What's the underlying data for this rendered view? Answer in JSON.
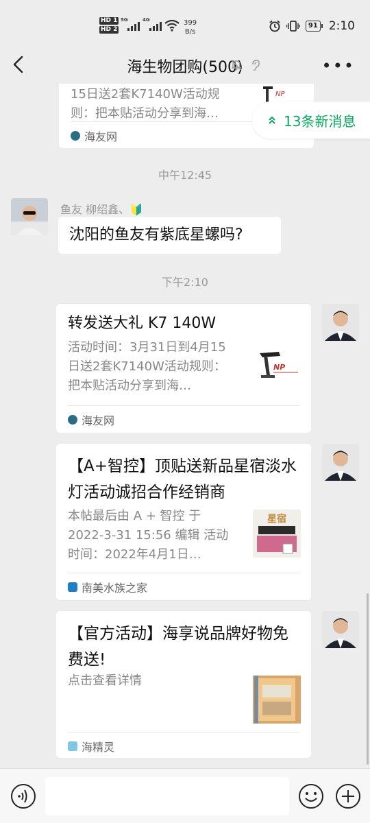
{
  "status_bar": {
    "sim1": "HD 1",
    "sim2": "HD 2",
    "net1": "5G",
    "net2": "4G",
    "speed_value": "399",
    "speed_unit": "B/s",
    "battery": "91",
    "time": "2:10"
  },
  "header": {
    "title": "海生物团购(500)"
  },
  "new_messages": "13条新消息",
  "messages": {
    "card_top": {
      "desc_line1": "15日送2套K7140W活动规",
      "desc_line2": "则：把本贴活动分享到海…",
      "source": "海友网"
    },
    "time1": "中午12:45",
    "msg1": {
      "sender": "鱼友 柳绍鑫、🔰",
      "text": "沈阳的鱼友有紫底星螺吗?"
    },
    "time2": "下午2:10",
    "card1": {
      "title": "转发送大礼 K7 140W",
      "desc": "活动时间：3月31日到4月15日送2套K7140W活动规则：把本贴活动分享到海…",
      "thumb_brand": "NP",
      "source": "海友网"
    },
    "card2": {
      "title": "【A+智控】顶贴送新品星宿淡水灯活动诚招合作经销商",
      "desc": " 本帖最后由 A + 智控 于 2022-3-31 15:56 编辑 活动时间：2022年4月1日…",
      "thumb_label": "星宿",
      "source": "南美水族之家"
    },
    "card3": {
      "title": "【官方活动】海享说品牌好物免费送!",
      "desc": "点击查看详情",
      "source": "海精灵"
    }
  },
  "colors": {
    "accent_green": "#07a85e",
    "background": "#ededed"
  }
}
